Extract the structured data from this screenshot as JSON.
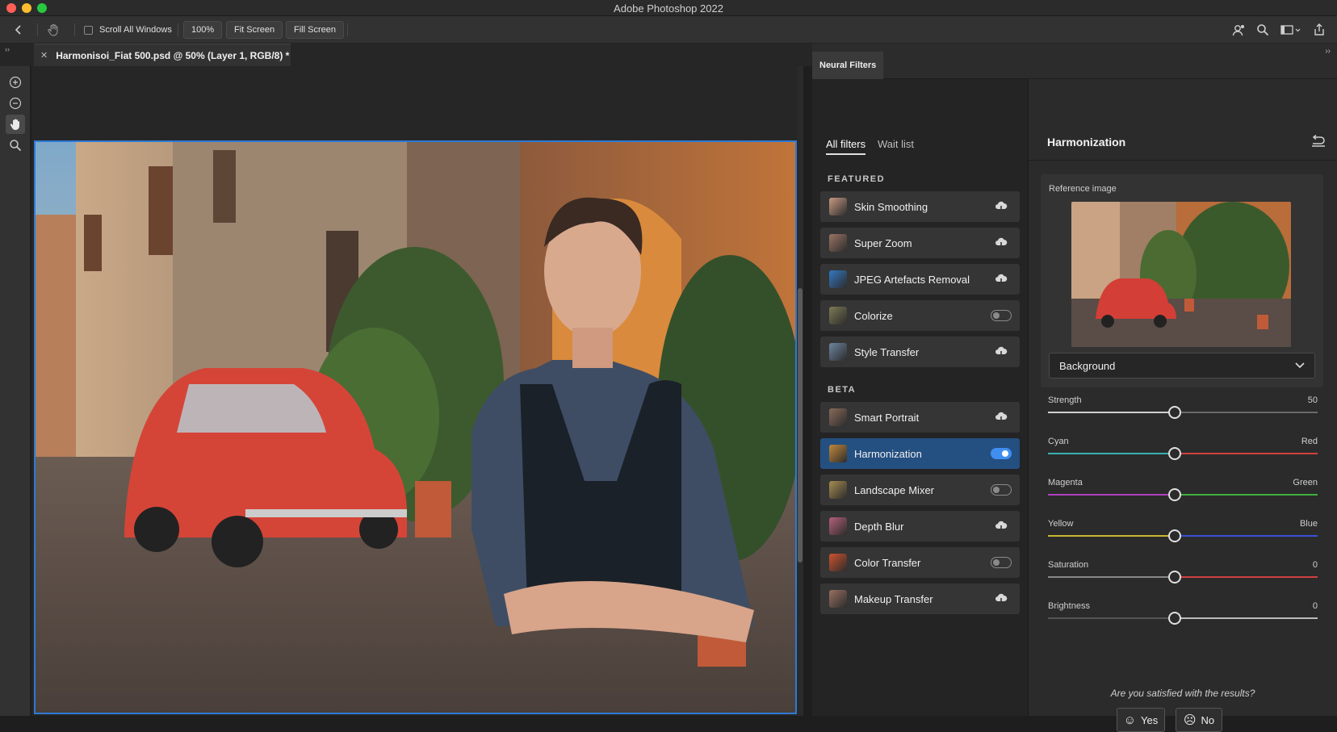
{
  "window": {
    "title": "Adobe Photoshop 2022"
  },
  "options_bar": {
    "scroll_all_windows": "Scroll All Windows",
    "zoom_button": "100%",
    "fit_screen": "Fit Screen",
    "fill_screen": "Fill Screen"
  },
  "document": {
    "tab_title": "Harmonisoi_Fiat 500.psd @ 50% (Layer 1, RGB/8) *"
  },
  "panel": {
    "tab": "Neural Filters"
  },
  "filters": {
    "tabs": [
      "All filters",
      "Wait list"
    ],
    "featured_label": "FEATURED",
    "beta_label": "BETA",
    "featured": [
      {
        "label": "Skin Smoothing",
        "action": "cloud",
        "thumb": "#c89a83"
      },
      {
        "label": "Super Zoom",
        "action": "cloud",
        "thumb": "#9b7464"
      },
      {
        "label": "JPEG Artefacts Removal",
        "action": "cloud",
        "thumb": "#3478c4"
      },
      {
        "label": "Colorize",
        "action": "toggle-off",
        "thumb": "#7d7a55"
      },
      {
        "label": "Style Transfer",
        "action": "cloud",
        "thumb": "#6d86a0"
      }
    ],
    "beta": [
      {
        "label": "Smart Portrait",
        "action": "cloud",
        "thumb": "#8a6a5a"
      },
      {
        "label": "Harmonization",
        "action": "toggle-on",
        "thumb": "#c2883a"
      },
      {
        "label": "Landscape Mixer",
        "action": "toggle-off",
        "thumb": "#a78d50"
      },
      {
        "label": "Depth Blur",
        "action": "cloud",
        "thumb": "#b5607a"
      },
      {
        "label": "Color Transfer",
        "action": "toggle-off",
        "thumb": "#d0522e"
      },
      {
        "label": "Makeup Transfer",
        "action": "cloud",
        "thumb": "#9a7060"
      }
    ]
  },
  "harmonization": {
    "title": "Harmonization",
    "reference_label": "Reference image",
    "layer_select": "Background",
    "sliders": [
      {
        "label": "Strength",
        "right": "50",
        "value": 0.47,
        "track": [
          "#cfcfcf",
          "#6a6a6a"
        ]
      },
      {
        "label": "Cyan",
        "right": "Red",
        "value": 0.47,
        "track": [
          "#3ab0b0",
          "#d04040"
        ]
      },
      {
        "label": "Magenta",
        "right": "Green",
        "value": 0.47,
        "track": [
          "#b040c0",
          "#40b040"
        ]
      },
      {
        "label": "Yellow",
        "right": "Blue",
        "value": 0.47,
        "track": [
          "#c8b830",
          "#3a50d8"
        ]
      },
      {
        "label": "Saturation",
        "right": "0",
        "value": 0.47,
        "track": [
          "#888888",
          "#d04040"
        ]
      },
      {
        "label": "Brightness",
        "right": "0",
        "value": 0.47,
        "track": [
          "#555555",
          "#bbbbbb"
        ]
      }
    ],
    "satisfied_question": "Are you satisfied with the results?",
    "yes": "Yes",
    "no": "No"
  }
}
